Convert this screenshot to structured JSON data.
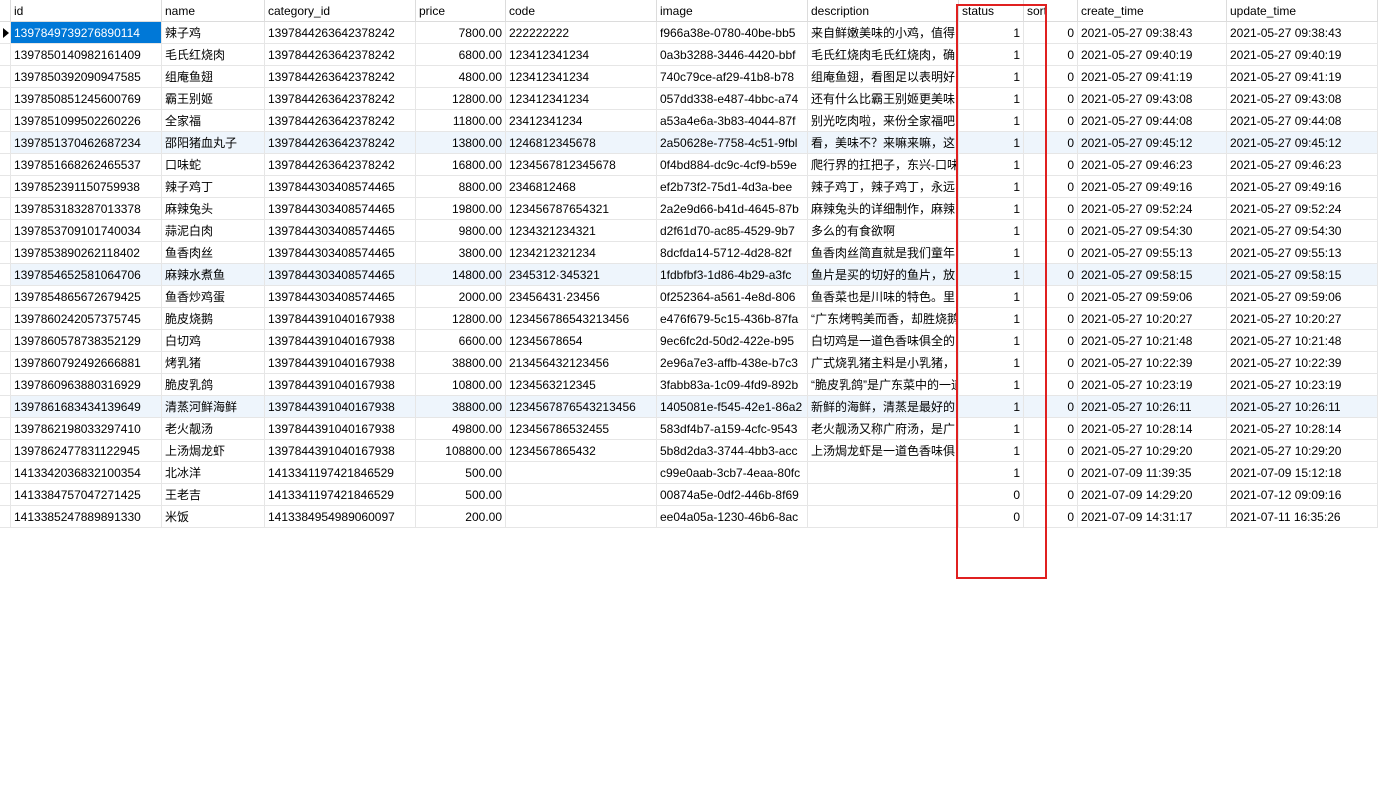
{
  "columns": [
    "id",
    "name",
    "category_id",
    "price",
    "code",
    "image",
    "description",
    "status",
    "sort",
    "create_time",
    "update_time"
  ],
  "rows": [
    [
      "1397849739276890114",
      "辣子鸡",
      "1397844263642378242",
      "7800.00",
      "222222222",
      "f966a38e-0780-40be-bb5",
      "来自鲜嫩美味的小鸡，值得",
      "1",
      "0",
      "2021-05-27 09:38:43",
      "2021-05-27 09:38:43"
    ],
    [
      "1397850140982161409",
      "毛氏红烧肉",
      "1397844263642378242",
      "6800.00",
      "123412341234",
      "0a3b3288-3446-4420-bbf",
      "毛氏红烧肉毛氏红烧肉，确",
      "1",
      "0",
      "2021-05-27 09:40:19",
      "2021-05-27 09:40:19"
    ],
    [
      "1397850392090947585",
      "组庵鱼翅",
      "1397844263642378242",
      "4800.00",
      "123412341234",
      "740c79ce-af29-41b8-b78",
      "组庵鱼翅，看图足以表明好",
      "1",
      "0",
      "2021-05-27 09:41:19",
      "2021-05-27 09:41:19"
    ],
    [
      "1397850851245600769",
      "霸王别姬",
      "1397844263642378242",
      "12800.00",
      "123412341234",
      "057dd338-e487-4bbc-a74",
      "还有什么比霸王别姬更美味",
      "1",
      "0",
      "2021-05-27 09:43:08",
      "2021-05-27 09:43:08"
    ],
    [
      "1397851099502260226",
      "全家福",
      "1397844263642378242",
      "11800.00",
      "23412341234",
      "a53a4e6a-3b83-4044-87f",
      "别光吃肉啦，来份全家福吧",
      "1",
      "0",
      "2021-05-27 09:44:08",
      "2021-05-27 09:44:08"
    ],
    [
      "1397851370462687234",
      "邵阳猪血丸子",
      "1397844263642378242",
      "13800.00",
      "1246812345678",
      "2a50628e-7758-4c51-9fbl",
      "看，美味不？来嘛来嘛，这",
      "1",
      "0",
      "2021-05-27 09:45:12",
      "2021-05-27 09:45:12"
    ],
    [
      "1397851668262465537",
      "口味蛇",
      "1397844263642378242",
      "16800.00",
      "1234567812345678",
      "0f4bd884-dc9c-4cf9-b59e",
      "爬行界的扛把子，东兴-口味",
      "1",
      "0",
      "2021-05-27 09:46:23",
      "2021-05-27 09:46:23"
    ],
    [
      "1397852391150759938",
      "辣子鸡丁",
      "1397844303408574465",
      "8800.00",
      "2346812468",
      "ef2b73f2-75d1-4d3a-bee",
      "辣子鸡丁，辣子鸡丁，永远",
      "1",
      "0",
      "2021-05-27 09:49:16",
      "2021-05-27 09:49:16"
    ],
    [
      "1397853183287013378",
      "麻辣兔头",
      "1397844303408574465",
      "19800.00",
      "123456787654321",
      "2a2e9d66-b41d-4645-87b",
      "麻辣兔头的详细制作，麻辣",
      "1",
      "0",
      "2021-05-27 09:52:24",
      "2021-05-27 09:52:24"
    ],
    [
      "1397853709101740034",
      "蒜泥白肉",
      "1397844303408574465",
      "9800.00",
      "1234321234321",
      "d2f61d70-ac85-4529-9b7",
      "多么的有食欲啊",
      "1",
      "0",
      "2021-05-27 09:54:30",
      "2021-05-27 09:54:30"
    ],
    [
      "1397853890262118402",
      "鱼香肉丝",
      "1397844303408574465",
      "3800.00",
      "1234212321234",
      "8dcfda14-5712-4d28-82f",
      "鱼香肉丝简直就是我们童年",
      "1",
      "0",
      "2021-05-27 09:55:13",
      "2021-05-27 09:55:13"
    ],
    [
      "1397854652581064706",
      "麻辣水煮鱼",
      "1397844303408574465",
      "14800.00",
      "2345312·345321",
      "1fdbfbf3-1d86-4b29-a3fc",
      "鱼片是买的切好的鱼片，放",
      "1",
      "0",
      "2021-05-27 09:58:15",
      "2021-05-27 09:58:15"
    ],
    [
      "1397854865672679425",
      "鱼香炒鸡蛋",
      "1397844303408574465",
      "2000.00",
      "23456431·23456",
      "0f252364-a561-4e8d-806",
      "鱼香菜也是川味的特色。里",
      "1",
      "0",
      "2021-05-27 09:59:06",
      "2021-05-27 09:59:06"
    ],
    [
      "1397860242057375745",
      "脆皮烧鹅",
      "1397844391040167938",
      "12800.00",
      "123456786543213456",
      "e476f679-5c15-436b-87fa",
      "“广东烤鸭美而香，却胜烧鹅",
      "1",
      "0",
      "2021-05-27 10:20:27",
      "2021-05-27 10:20:27"
    ],
    [
      "1397860578738352129",
      "白切鸡",
      "1397844391040167938",
      "6600.00",
      "12345678654",
      "9ec6fc2d-50d2-422e-b95",
      "白切鸡是一道色香味俱全的",
      "1",
      "0",
      "2021-05-27 10:21:48",
      "2021-05-27 10:21:48"
    ],
    [
      "1397860792492666881",
      "烤乳猪",
      "1397844391040167938",
      "38800.00",
      "213456432123456",
      "2e96a7e3-affb-438e-b7c3",
      "广式烧乳猪主料是小乳猪，",
      "1",
      "0",
      "2021-05-27 10:22:39",
      "2021-05-27 10:22:39"
    ],
    [
      "1397860963880316929",
      "脆皮乳鸽",
      "1397844391040167938",
      "10800.00",
      "1234563212345",
      "3fabb83a-1c09-4fd9-892b",
      "“脆皮乳鸽”是广东菜中的一道",
      "1",
      "0",
      "2021-05-27 10:23:19",
      "2021-05-27 10:23:19"
    ],
    [
      "1397861683434139649",
      "清蒸河鲜海鲜",
      "1397844391040167938",
      "38800.00",
      "1234567876543213456",
      "1405081e-f545-42e1-86a2",
      "新鲜的海鲜，清蒸是最好的",
      "1",
      "0",
      "2021-05-27 10:26:11",
      "2021-05-27 10:26:11"
    ],
    [
      "1397862198033297410",
      "老火靓汤",
      "1397844391040167938",
      "49800.00",
      "123456786532455",
      "583df4b7-a159-4cfc-9543",
      "老火靓汤又称广府汤，是广",
      "1",
      "0",
      "2021-05-27 10:28:14",
      "2021-05-27 10:28:14"
    ],
    [
      "1397862477831122945",
      "上汤焗龙虾",
      "1397844391040167938",
      "108800.00",
      "1234567865432",
      "5b8d2da3-3744-4bb3-acc",
      "上汤焗龙虾是一道色香味俱",
      "1",
      "0",
      "2021-05-27 10:29:20",
      "2021-05-27 10:29:20"
    ],
    [
      "1413342036832100354",
      "北冰洋",
      "1413341197421846529",
      "500.00",
      "",
      "c99e0aab-3cb7-4eaa-80fc",
      "",
      "1",
      "0",
      "2021-07-09 11:39:35",
      "2021-07-09 15:12:18"
    ],
    [
      "1413384757047271425",
      "王老吉",
      "1413341197421846529",
      "500.00",
      "",
      "00874a5e-0df2-446b-8f69",
      "",
      "0",
      "0",
      "2021-07-09 14:29:20",
      "2021-07-12 09:09:16"
    ],
    [
      "1413385247889891330",
      "米饭",
      "1413384954989060097",
      "200.00",
      "",
      "ee04a05a-1230-46b6-8ac",
      "",
      "0",
      "0",
      "2021-07-09 14:31:17",
      "2021-07-11 16:35:26"
    ]
  ],
  "selected_row": 0,
  "accent_colors": {
    "selection": "#0078d7",
    "highlight_box": "#e02020",
    "alt_row": "#eef5fc"
  }
}
